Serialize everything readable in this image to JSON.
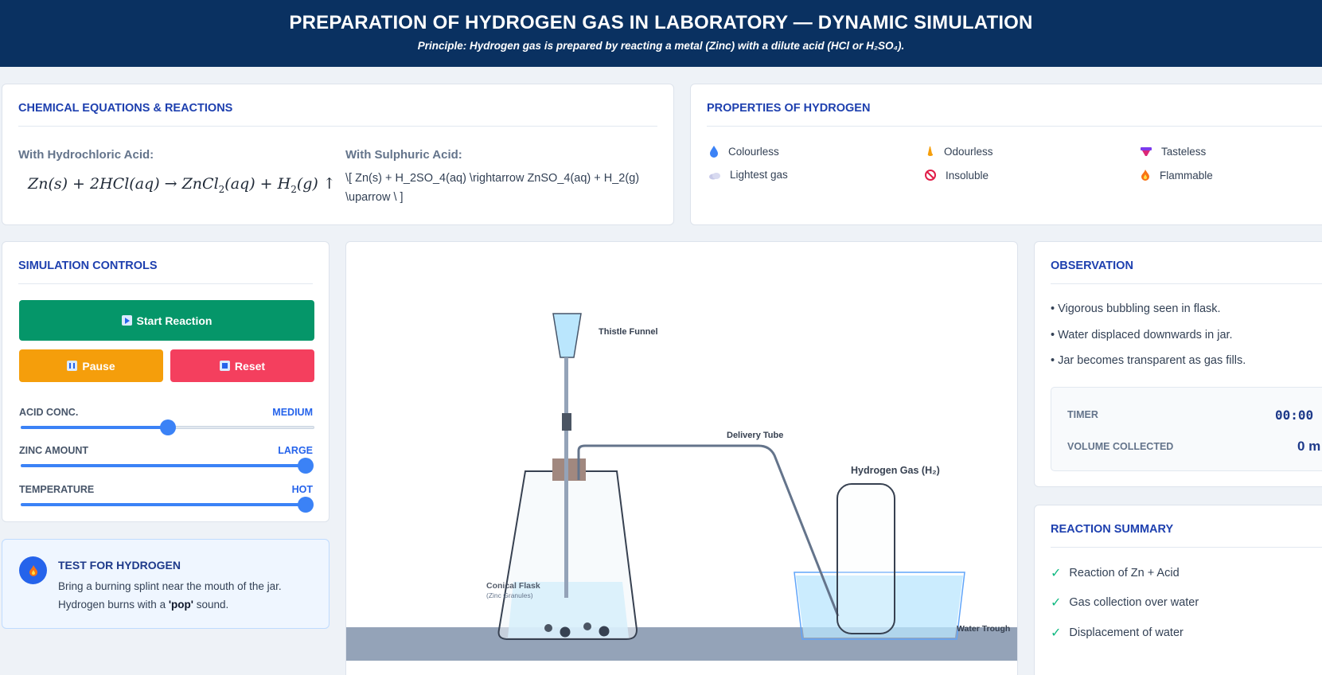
{
  "header": {
    "title": "PREPARATION OF HYDROGEN GAS IN LABORATORY — DYNAMIC SIMULATION",
    "principle": "Principle: Hydrogen gas is prepared by reacting a metal (Zinc) with a dilute acid (HCl or H₂SO₄)."
  },
  "equations": {
    "title": "CHEMICAL EQUATIONS & REACTIONS",
    "hcl_title": "With Hydrochloric Acid:",
    "h2so4_title": "With Sulphuric Acid:",
    "h2so4_raw": "\\[ Zn(s) + H_2SO_4(aq) \\rightarrow ZnSO_4(aq) + H_2(g) \\uparrow \\ ]"
  },
  "properties": {
    "title": "PROPERTIES OF HYDROGEN",
    "items": [
      {
        "label": "Colourless",
        "icon": "droplet-icon",
        "color": "#3b82f6"
      },
      {
        "label": "Odourless",
        "icon": "nose-icon",
        "color": "#f59e0b"
      },
      {
        "label": "Tasteless",
        "icon": "tongue-icon",
        "color": "#db2777"
      },
      {
        "label": "Lightest gas",
        "icon": "cloud-icon",
        "color": "#c7c9e8"
      },
      {
        "label": "Insoluble",
        "icon": "prohibited-icon",
        "color": "#e11d48"
      },
      {
        "label": "Flammable",
        "icon": "fire-icon",
        "color": "#f97316"
      }
    ]
  },
  "controls": {
    "title": "SIMULATION CONTROLS",
    "start": "Start Reaction",
    "pause": "Pause",
    "reset": "Reset",
    "sliders": [
      {
        "label": "ACID CONC.",
        "value_text": "MEDIUM",
        "level": 0.5
      },
      {
        "label": "ZINC AMOUNT",
        "value_text": "LARGE",
        "level": 1.0
      },
      {
        "label": "TEMPERATURE",
        "value_text": "HOT",
        "level": 1.0
      }
    ],
    "colors": {
      "start": "#059669",
      "pause": "#f59e0b",
      "reset": "#f43f5e",
      "accent": "#3b82f6"
    }
  },
  "test": {
    "title": "TEST FOR HYDROGEN",
    "line1": "Bring a burning splint near the mouth of the jar.",
    "line2_pre": "Hydrogen burns with a ",
    "line2_bold": "'pop'",
    "line2_post": " sound."
  },
  "apparatus": {
    "thistle_funnel": "Thistle Funnel",
    "delivery_tube": "Delivery Tube",
    "gas_label": "Hydrogen Gas (H₂)",
    "flask": "Conical Flask",
    "flask_sub": "(Zinc Granules)",
    "trough": "Water Trough"
  },
  "observation": {
    "title": "OBSERVATION",
    "items": [
      "• Vigorous bubbling seen in flask.",
      "• Water displaced downwards in jar.",
      "• Jar becomes transparent as gas fills."
    ],
    "timer_label": "TIMER",
    "timer_value": "00:00",
    "volume_label": "VOLUME COLLECTED",
    "volume_value": "0 m"
  },
  "summary": {
    "title": "REACTION SUMMARY",
    "items": [
      "Reaction of Zn + Acid",
      "Gas collection over water",
      "Displacement of water"
    ]
  }
}
